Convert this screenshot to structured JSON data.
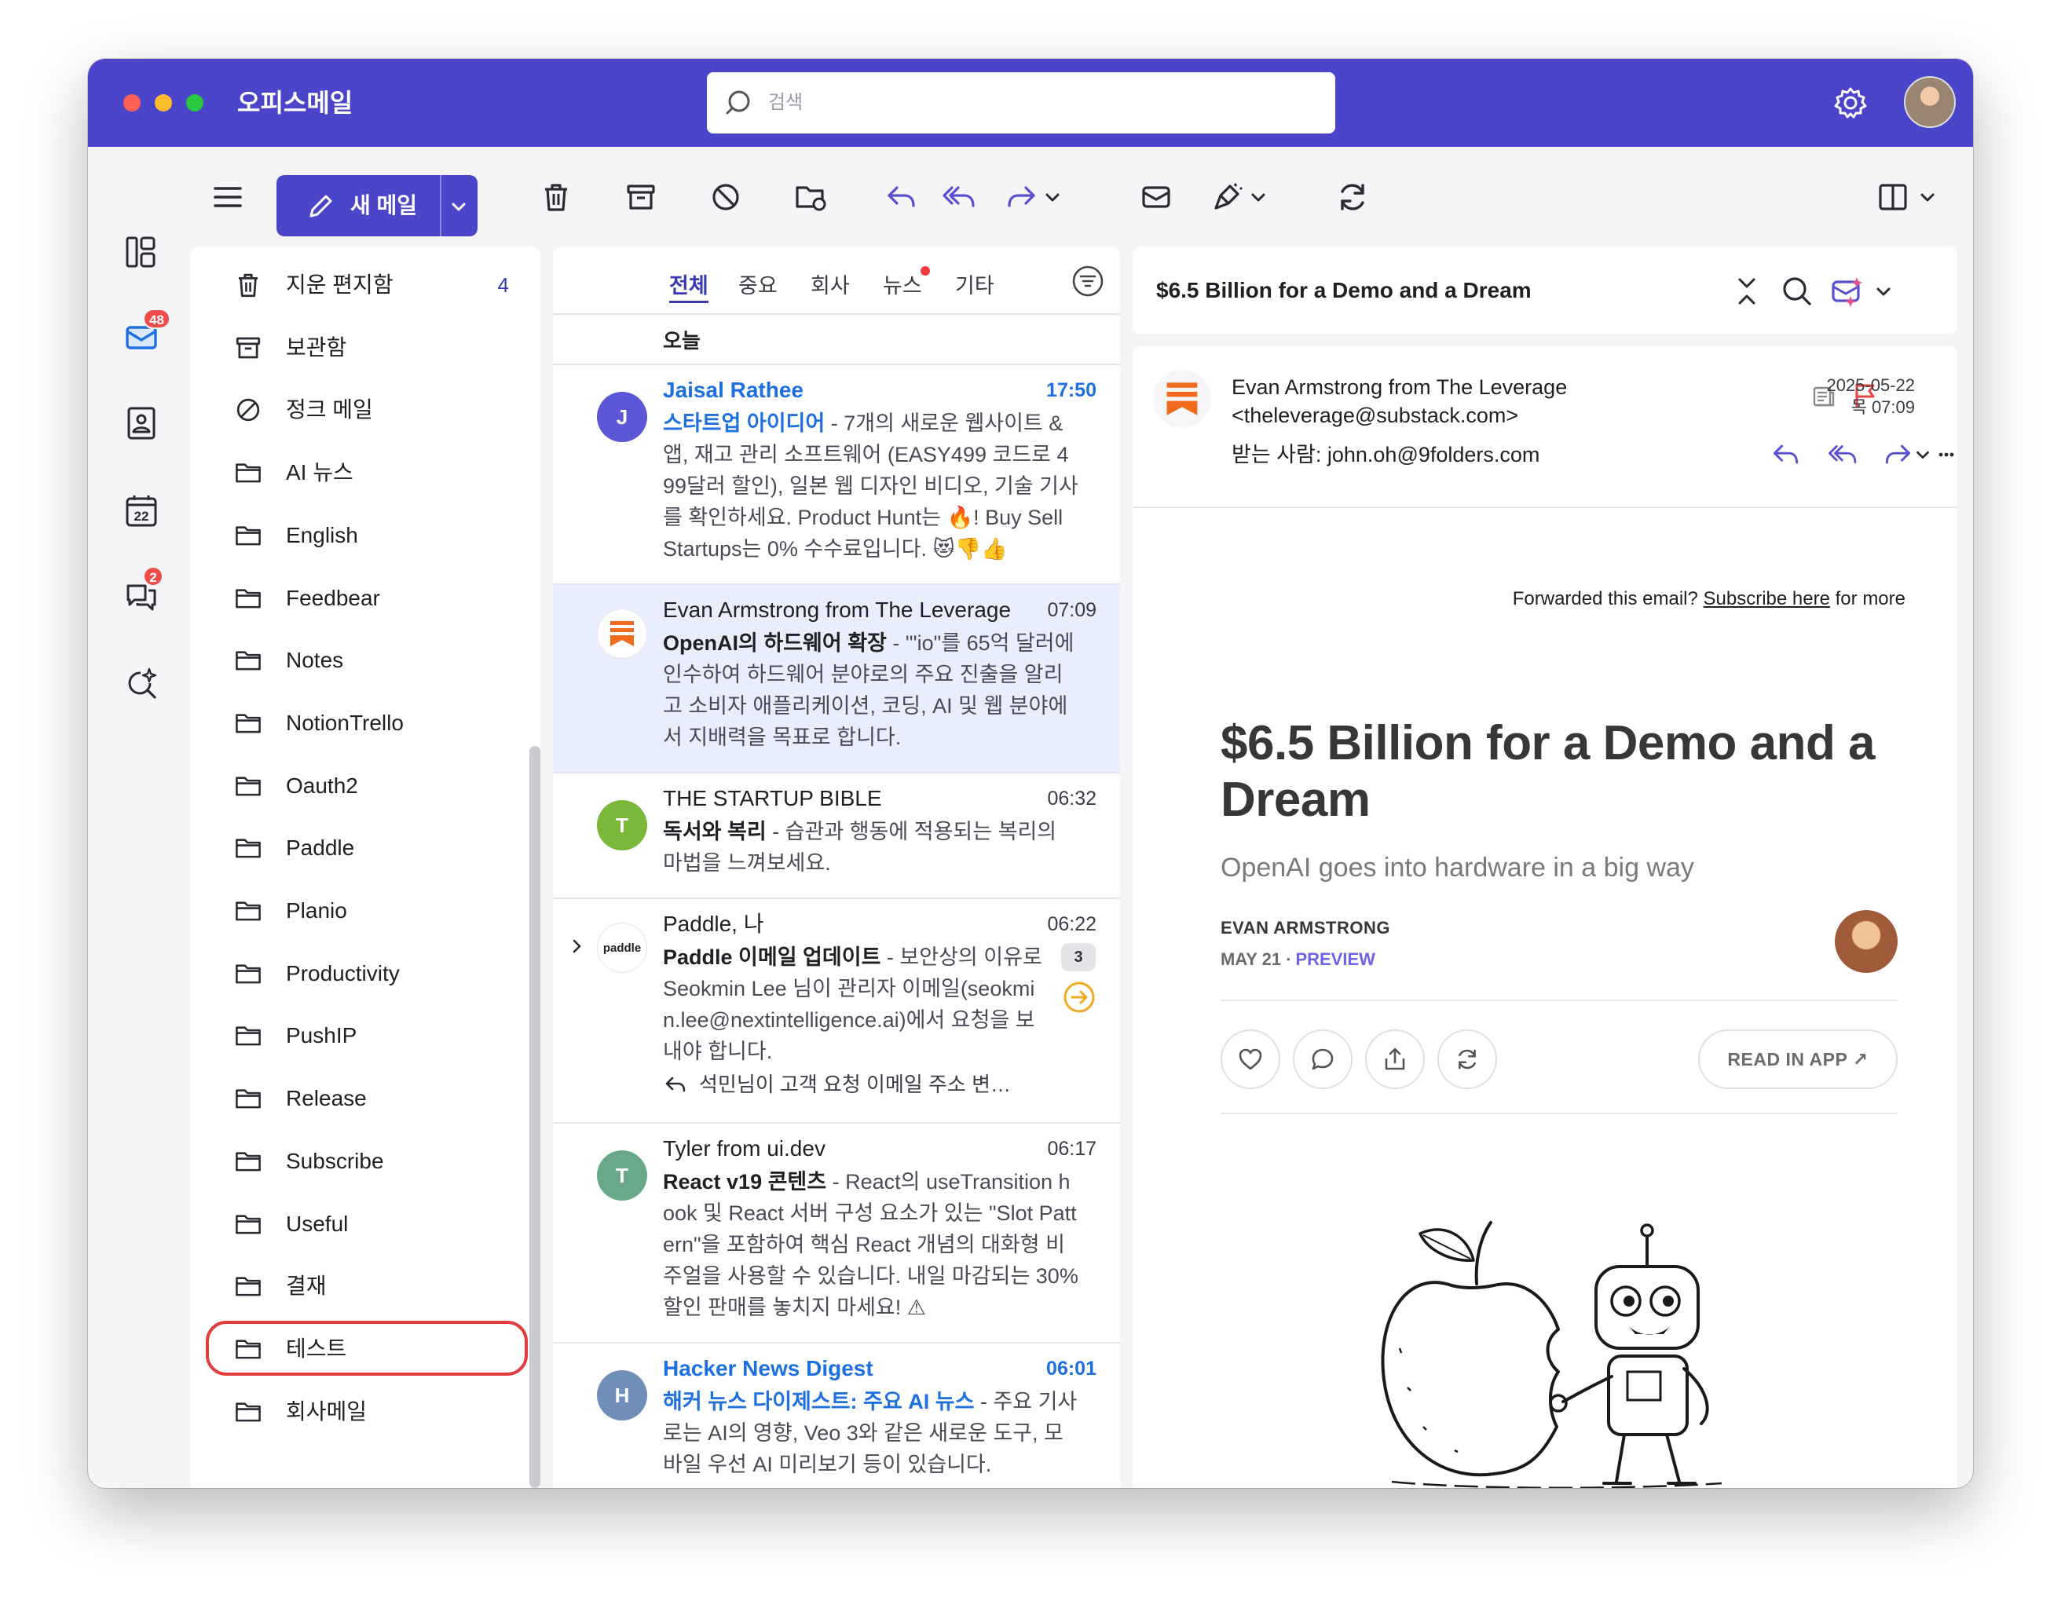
{
  "app": {
    "title": "오피스메일"
  },
  "search": {
    "placeholder": "검색"
  },
  "toolbar": {
    "new_mail_label": "새 메일"
  },
  "rail": {
    "mail_badge": "48",
    "chat_badge": "2",
    "calendar_day": "22"
  },
  "folders": [
    {
      "label": "지운 편지함",
      "icon": "trash-icon",
      "count": "4"
    },
    {
      "label": "보관함",
      "icon": "archive-icon"
    },
    {
      "label": "정크 메일",
      "icon": "block-icon"
    },
    {
      "label": "AI 뉴스",
      "icon": "folder-icon"
    },
    {
      "label": "English",
      "icon": "folder-icon"
    },
    {
      "label": "Feedbear",
      "icon": "folder-icon"
    },
    {
      "label": "Notes",
      "icon": "folder-icon"
    },
    {
      "label": "NotionTrello",
      "icon": "folder-icon"
    },
    {
      "label": "Oauth2",
      "icon": "folder-icon"
    },
    {
      "label": "Paddle",
      "icon": "folder-icon"
    },
    {
      "label": "Planio",
      "icon": "folder-icon"
    },
    {
      "label": "Productivity",
      "icon": "folder-icon"
    },
    {
      "label": "PushIP",
      "icon": "folder-icon"
    },
    {
      "label": "Release",
      "icon": "folder-icon"
    },
    {
      "label": "Subscribe",
      "icon": "folder-icon"
    },
    {
      "label": "Useful",
      "icon": "folder-icon"
    },
    {
      "label": "결재",
      "icon": "folder-icon"
    },
    {
      "label": "테스트",
      "icon": "folder-icon",
      "highlighted": true
    },
    {
      "label": "회사메일",
      "icon": "folder-icon"
    }
  ],
  "tabs": [
    {
      "label": "전체",
      "active": true
    },
    {
      "label": "중요"
    },
    {
      "label": "회사"
    },
    {
      "label": "뉴스",
      "dot": true
    },
    {
      "label": "기타"
    }
  ],
  "list": {
    "day": "오늘",
    "mails": [
      {
        "avatar": "J",
        "avatar_color": "#5b57d6",
        "sender": "Jaisal Rathee",
        "time": "17:50",
        "unread": true,
        "subject": "스타트업 아이디어",
        "snippet": " - 7개의 새로운 웹사이트 & 앱, 재고 관리 소프트웨어 (EASY499 코드로 499달러 할인), 일본 웹 디자인 비디오, 기술 기사를 확인하세요. Product Hunt는 🔥! Buy Sell Startups는 0% 수수료입니다. 😻👎👍"
      },
      {
        "avatar": "",
        "avatar_color": "#ffffff",
        "sender": "Evan Armstrong from The Leverage",
        "time": "07:09",
        "selected": true,
        "subject": "OpenAI의 하드웨어 확장",
        "snippet": " - \"'io\"를 65억 달러에 인수하여 하드웨어 분야로의 주요 진출을 알리고 소비자 애플리케이션, 코딩, AI 및 웹 분야에서 지배력을 목표로 합니다."
      },
      {
        "avatar": "T",
        "avatar_color": "#7ab83a",
        "sender": "THE STARTUP BIBLE",
        "time": "06:32",
        "subject": "독서와 복리",
        "snippet": " - 습관과 행동에 적용되는 복리의 마법을 느껴보세요."
      },
      {
        "avatar": "paddle",
        "avatar_color": "#ffffff",
        "sender": "Paddle, 나",
        "time": "06:22",
        "thread_count": "3",
        "subject": "Paddle 이메일 업데이트",
        "snippet": " - 보안상의 이유로 Seokmin Lee 님이 관리자 이메일(seokmin.lee@nextintelligence.ai)에서 요청을 보내야 합니다.",
        "reply_preview": "석민님이 고객 요청 이메일 주소 변…"
      },
      {
        "avatar": "T",
        "avatar_color": "#6aa889",
        "sender": "Tyler from ui.dev",
        "time": "06:17",
        "subject": "React v19 콘텐츠",
        "snippet": " - React의 useTransition hook 및 React 서버 구성 요소가 있는 \"Slot Pattern\"을 포함하여 핵심 React 개념의 대화형 비주얼을 사용할 수 있습니다. 내일 마감되는 30% 할인 판매를 놓치지 마세요! ⚠"
      },
      {
        "avatar": "H",
        "avatar_color": "#6f8fb8",
        "sender": "Hacker News Digest",
        "time": "06:01",
        "unread": true,
        "subject": "해커 뉴스 다이제스트: 주요 AI 뉴스",
        "snippet": " - 주요 기사로는 AI의 영향, Veo 3와 같은 새로운 도구, 모바일 우선 AI 미리보기 등이 있습니다."
      }
    ]
  },
  "reader": {
    "header_title": "$6.5 Billion for a Demo and a Dream",
    "from_name": "Evan Armstrong from The Leverage",
    "from_email": "<theleverage@substack.com>",
    "to": "받는 사람: john.oh@9folders.com",
    "date": "2025-05-22",
    "time": "목 07:09",
    "forwarded_text": "Forwarded this email?",
    "subscribe_link": "Subscribe here",
    "for_more": "for more",
    "article_title": "$6.5 Billion for a Demo and a Dream",
    "article_subtitle": "OpenAI goes into hardware in a big way",
    "author": "EVAN ARMSTRONG",
    "article_date": "MAY 21",
    "dot": "∙",
    "preview_label": "PREVIEW",
    "read_in_app": "READ IN APP ↗"
  },
  "colors": {
    "brand": "#4b45c9",
    "unread": "#1e6fe0",
    "highlight": "#e23d3d",
    "selected_row": "#e8eefb"
  }
}
